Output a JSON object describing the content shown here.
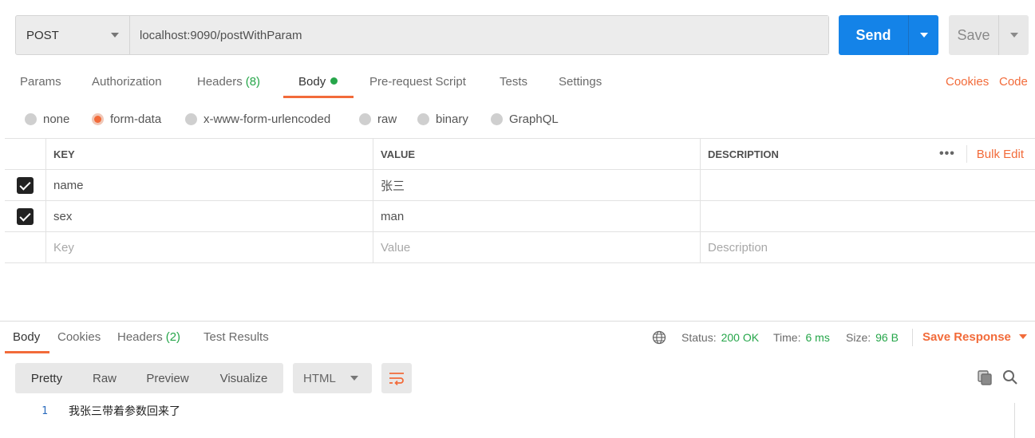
{
  "request": {
    "method": "POST",
    "url": "localhost:9090/postWithParam",
    "send_label": "Send",
    "save_label": "Save"
  },
  "tabs": {
    "params": "Params",
    "authorization": "Authorization",
    "headers": "Headers",
    "headers_count": "(8)",
    "body": "Body",
    "pre_request": "Pre-request Script",
    "tests": "Tests",
    "settings": "Settings",
    "cookies": "Cookies",
    "code": "Code"
  },
  "body_types": {
    "none": "none",
    "form_data": "form-data",
    "urlencoded": "x-www-form-urlencoded",
    "raw": "raw",
    "binary": "binary",
    "graphql": "GraphQL",
    "selected": "form-data"
  },
  "table": {
    "headers": {
      "key": "KEY",
      "value": "VALUE",
      "description": "DESCRIPTION",
      "more": "•••",
      "bulk_edit": "Bulk Edit"
    },
    "rows": [
      {
        "checked": true,
        "key": "name",
        "value": "张三",
        "description": ""
      },
      {
        "checked": true,
        "key": "sex",
        "value": "man",
        "description": ""
      }
    ],
    "placeholder": {
      "key": "Key",
      "value": "Value",
      "description": "Description"
    }
  },
  "response": {
    "tabs": {
      "body": "Body",
      "cookies": "Cookies",
      "headers": "Headers",
      "headers_count": "(2)",
      "test_results": "Test Results"
    },
    "status_label": "Status:",
    "status_value": "200 OK",
    "time_label": "Time:",
    "time_value": "6 ms",
    "size_label": "Size:",
    "size_value": "96 B",
    "save_response": "Save Response",
    "views": {
      "pretty": "Pretty",
      "raw": "Raw",
      "preview": "Preview",
      "visualize": "Visualize"
    },
    "format": "HTML",
    "lines": [
      {
        "number": "1",
        "text": "我张三带着参数回来了"
      }
    ]
  },
  "colors": {
    "send": "#1483e8",
    "accent": "#f26b3a",
    "success": "#26a64a"
  }
}
